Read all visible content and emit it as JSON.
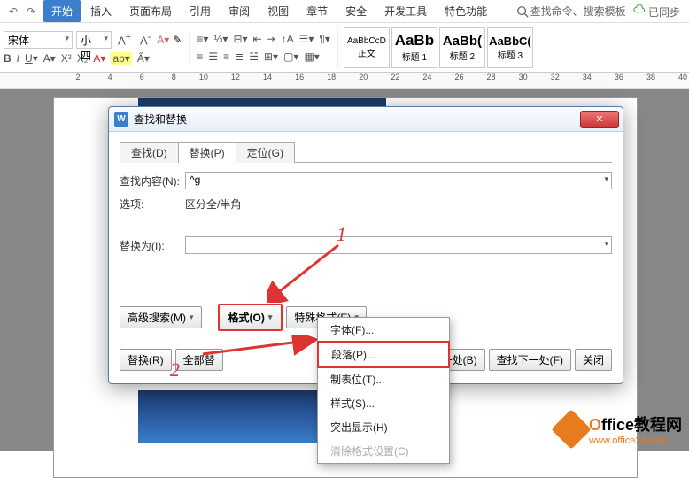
{
  "ribbon": {
    "tabs": [
      "开始",
      "插入",
      "页面布局",
      "引用",
      "审阅",
      "视图",
      "章节",
      "安全",
      "开发工具",
      "特色功能"
    ],
    "active_index": 0,
    "search_placeholder": "查找命令、搜索模板",
    "sync": "已同步"
  },
  "fontgroup": {
    "font_name": "宋体",
    "font_size": "小四"
  },
  "styles": [
    {
      "preview": "AaBbCcD",
      "label": "正文",
      "prev_size": "12px",
      "prev_weight": "normal"
    },
    {
      "preview": "AaBb",
      "label": "标题 1",
      "prev_size": "17px",
      "prev_weight": "bold"
    },
    {
      "preview": "AaBb(",
      "label": "标题 2",
      "prev_size": "15px",
      "prev_weight": "bold"
    },
    {
      "preview": "AaBbC(",
      "label": "标题 3",
      "prev_size": "13px",
      "prev_weight": "bold"
    }
  ],
  "ruler": [
    "2",
    "4",
    "6",
    "8",
    "10",
    "12",
    "14",
    "16",
    "18",
    "20",
    "22",
    "24",
    "26",
    "28",
    "30",
    "32",
    "34",
    "36",
    "38",
    "40"
  ],
  "dialog": {
    "title": "查找和替换",
    "tabs": [
      "查找(D)",
      "替换(P)",
      "定位(G)"
    ],
    "active_tab": 1,
    "find_label": "查找内容(N):",
    "find_value": "^g",
    "options_label": "选项:",
    "options_value": "区分全/半角",
    "replace_label": "替换为(I):",
    "replace_value": "",
    "adv_search": "高级搜索(M)",
    "format_btn": "格式(O)",
    "special_btn": "特殊格式(E)",
    "replace_btn": "替换(R)",
    "replace_all_btn": "全部替",
    "find_prev": "查找上一处(B)",
    "find_next": "查找下一处(F)",
    "close_btn": "关闭"
  },
  "menu": {
    "items": [
      "字体(F)...",
      "段落(P)...",
      "制表位(T)...",
      "样式(S)...",
      "突出显示(H)"
    ],
    "highlight_index": 1,
    "disabled": "清除格式设置(C)"
  },
  "annotations": {
    "n1": "1",
    "n2": "2"
  },
  "watermark": {
    "brand_prefix": "O",
    "brand_rest": "ffice教程网",
    "url": "www.office26.com"
  }
}
